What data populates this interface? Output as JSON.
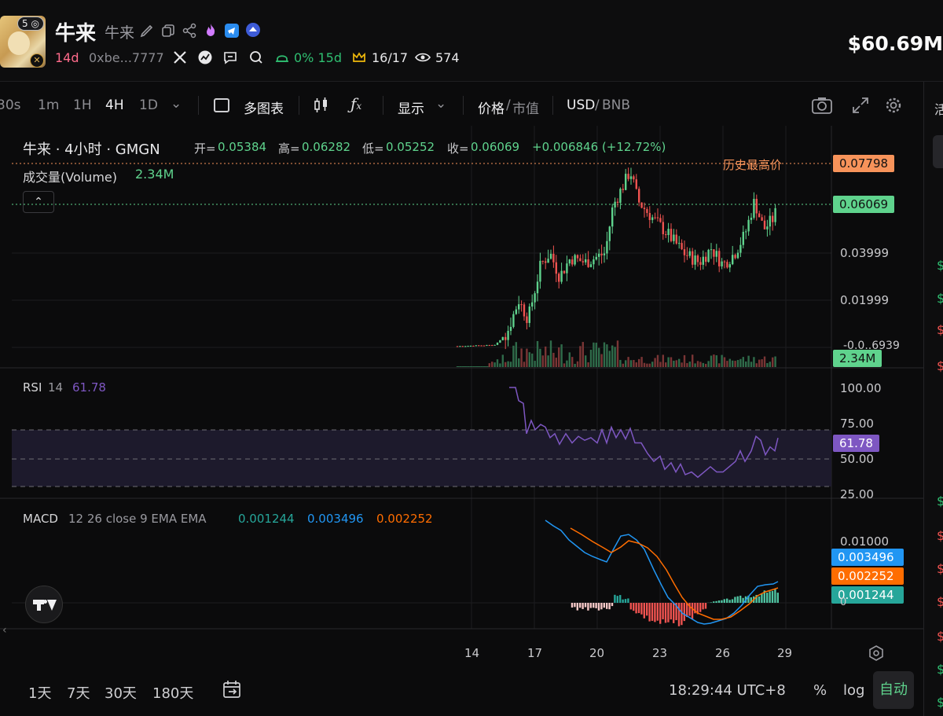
{
  "header": {
    "token_name": "牛来",
    "token_sub": "牛来",
    "rank_badge": "5",
    "age": "14d",
    "address": "0xbe...7777",
    "holders_pct": "0% 15d",
    "rank_ratio": "16/17",
    "views": "574",
    "price": "$60.69M",
    "icons": [
      "edit-icon",
      "copy-icon",
      "share-icon",
      "flame-icon",
      "telegram-icon",
      "badge-icon",
      "x-icon",
      "globe-icon",
      "chat-icon",
      "search-icon",
      "hat-icon",
      "crown-icon",
      "eye-icon"
    ]
  },
  "toolbar": {
    "intervals": [
      "30s",
      "1m",
      "1H",
      "4H",
      "1D"
    ],
    "active_interval": "4H",
    "multi_chart": "多图表",
    "display": "显示",
    "price_label": "价格",
    "mcap_label": "市值",
    "usd": "USD",
    "bnb": "BNB"
  },
  "legend": {
    "title": "牛来 · 4小时 · GMGN",
    "open_k": "开=",
    "open_v": "0.05384",
    "high_k": "高=",
    "high_v": "0.06282",
    "low_k": "低=",
    "low_v": "0.05252",
    "close_k": "收=",
    "close_v": "0.06069",
    "change": "+0.006846 (+12.72%)",
    "volume_label": "成交量(Volume)",
    "volume_value": "2.34M",
    "ath_label": "历史最高价"
  },
  "price_axis": {
    "ath_tag": "0.07798",
    "last_tag": "0.06069",
    "ticks": [
      "0.03999",
      "0.01999"
    ],
    "overlap_text": "-0.0..6939",
    "volume_tag": "2.34M"
  },
  "rsi": {
    "label": "RSI",
    "period": "14",
    "value": "61.78",
    "ticks": [
      "100.00",
      "75.00",
      "50.00",
      "25.00"
    ],
    "tag": "61.78"
  },
  "macd": {
    "label": "MACD",
    "params": "12 26 close 9 EMA EMA",
    "hist": "0.001244",
    "macd": "0.003496",
    "signal": "0.002252",
    "tick": "0.01000",
    "zero": "0",
    "tags": [
      "0.003496",
      "0.002252",
      "0.001244"
    ]
  },
  "time_axis": [
    "14",
    "17",
    "20",
    "23",
    "26",
    "29"
  ],
  "bottom": {
    "ranges": [
      "1天",
      "7天",
      "30天",
      "180天"
    ],
    "clock": "18:29:44 UTC+8",
    "percent": "%",
    "log": "log",
    "auto": "自动"
  },
  "colors": {
    "up": "#26a69a",
    "up_bright": "#5fd38d",
    "down": "#ef5350",
    "ath": "#f7935a",
    "rsi": "#7e57c2",
    "macd": "#2196f3",
    "signal": "#ff6d00"
  },
  "chart_data": {
    "type": "candlestick",
    "title": "牛来 · 4小时 · GMGN",
    "x_ticks": [
      "14",
      "17",
      "20",
      "23",
      "26",
      "29"
    ],
    "price_range": [
      -0.006939,
      0.07798
    ],
    "last_close": 0.06069,
    "all_time_high": 0.07798,
    "rsi_value": 61.78,
    "rsi_range": [
      25,
      100
    ],
    "macd_values": {
      "hist": 0.001244,
      "macd": 0.003496,
      "signal": 0.002252
    }
  }
}
